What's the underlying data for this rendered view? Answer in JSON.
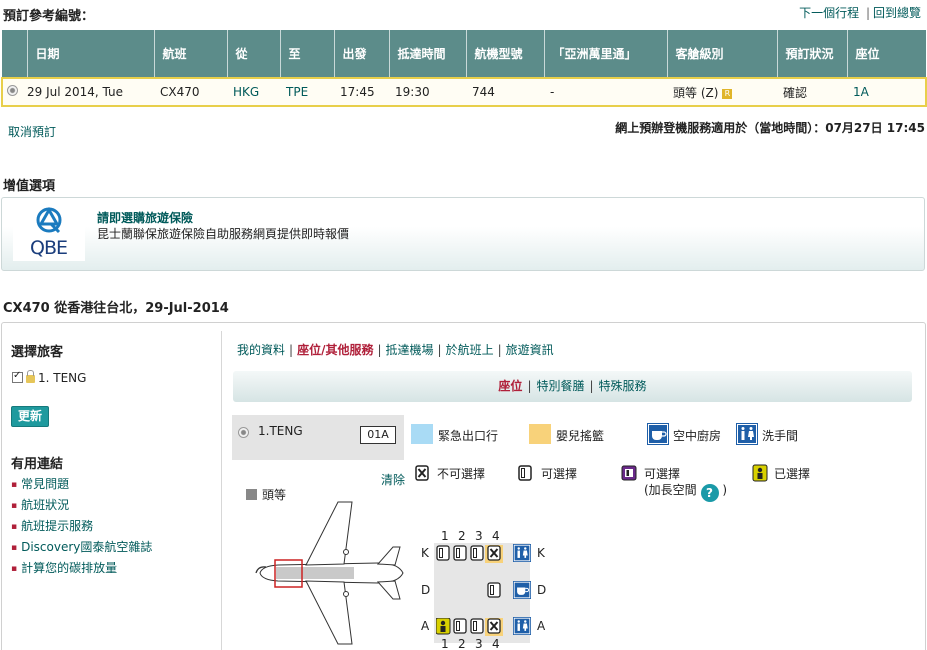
{
  "header": {
    "booking_ref_label": "預訂參考編號：",
    "next_itinerary": "下一個行程",
    "separator": "|",
    "back_to_overview": "回到總覽"
  },
  "flight_table": {
    "columns": [
      "日期",
      "航班",
      "從",
      "至",
      "出發",
      "抵達時間",
      "航機型號",
      "「亞洲萬里通」",
      "客艙級別",
      "預訂狀況",
      "座位"
    ],
    "row": {
      "date": "29 Jul 2014, Tue",
      "flight": "CX470",
      "from": "HKG",
      "to": "TPE",
      "depart": "17:45",
      "arrive": "19:30",
      "aircraft": "744",
      "asia_miles": "-",
      "cabin": "頭等 (Z)",
      "cabin_badge": "R",
      "status": "確認",
      "seat": "1A"
    }
  },
  "cancel_booking": "取消預訂",
  "checkin_note": "網上預辦登機服務適用於（當地時間）：07月27日 17:45",
  "value_added": {
    "title": "增值選項",
    "qbe_logo_text": "QBE",
    "insurance_title": "請即選購旅遊保險",
    "insurance_sub": "昆士蘭聯保旅遊保險自助服務網頁提供即時報價"
  },
  "flight_route": "CX470 從香港往台北，29-Jul-2014",
  "sidebar": {
    "select_passenger": "選擇旅客",
    "passenger": "1. TENG",
    "update_button": "更新",
    "useful_links_title": "有用連結",
    "links": [
      "常見問題",
      "航班狀況",
      "航班提示服務",
      "Discovery國泰航空雜誌",
      "計算您的碳排放量"
    ]
  },
  "nav": {
    "tabs": [
      "我的資料",
      "座位/其他服務",
      "抵達機場",
      "於航班上",
      "旅遊資訊"
    ],
    "active_tab": "座位/其他服務",
    "sub_tabs": [
      "座位",
      "特別餐膳",
      "特殊服務"
    ],
    "active_sub_tab": "座位"
  },
  "seat_panel": {
    "passenger_name": "1.TENG",
    "seat": "01A",
    "clear": "清除",
    "cabin_label": "頭等"
  },
  "legend": {
    "exit_row": "緊急出口行",
    "bassinet": "嬰兒搖籃",
    "galley": "空中廚房",
    "lavatory": "洗手間",
    "unavailable": "不可選擇",
    "available": "可選擇",
    "extra_legroom": "可選擇",
    "extra_legroom_note": "(加長空間",
    "extra_legroom_close": ")",
    "selected": "已選擇",
    "help_icon_text": "?"
  },
  "seat_map": {
    "row_numbers": [
      "1",
      "2",
      "3",
      "4"
    ],
    "columns": [
      "K",
      "D",
      "A"
    ]
  },
  "colors": {
    "header_teal": "#5c8c8a",
    "accent_red": "#b0203a",
    "link_teal": "#005a5a",
    "exit_row_blue": "#a9dbf5",
    "bassinet_yellow": "#f8d27a",
    "galley_blue": "#1f5fa8",
    "selected_highlight": "#cc2222"
  }
}
